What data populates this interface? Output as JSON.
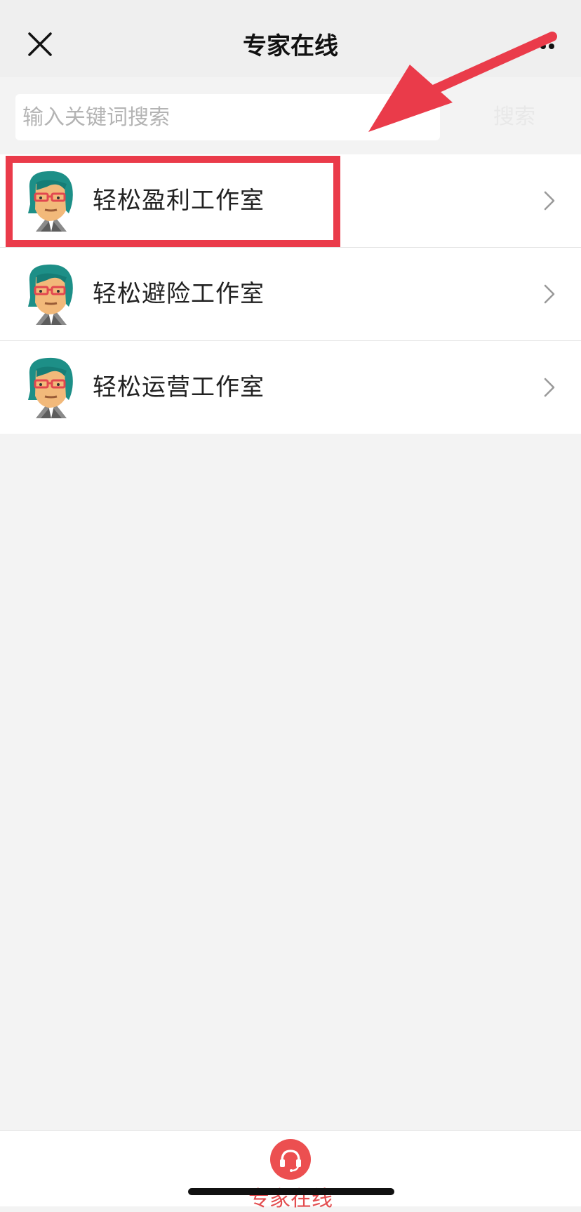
{
  "header": {
    "title": "专家在线",
    "close_icon": "close-icon",
    "more_icon": "more-icon"
  },
  "search": {
    "placeholder": "输入关键词搜索",
    "button_label": "搜索"
  },
  "list": {
    "items": [
      {
        "label": "轻松盈利工作室",
        "avatar": "cartoon-avatar",
        "highlighted": true
      },
      {
        "label": "轻松避险工作室",
        "avatar": "cartoon-avatar",
        "highlighted": false
      },
      {
        "label": "轻松运营工作室",
        "avatar": "cartoon-avatar",
        "highlighted": false
      }
    ]
  },
  "bottom_tab": {
    "label": "专家在线",
    "icon": "headset-icon"
  },
  "colors": {
    "accent": "#ea3b4a",
    "tab_icon": "#ec4f50",
    "background": "#f3f3f3"
  }
}
